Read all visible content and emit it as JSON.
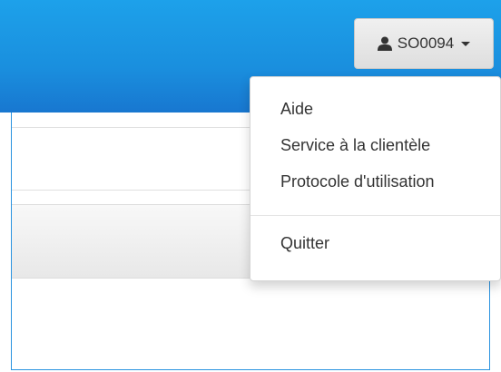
{
  "header": {
    "user_menu": {
      "label": "SO0094",
      "icon": "user-icon",
      "caret_icon": "caret-down-icon"
    }
  },
  "dropdown": {
    "items": [
      {
        "label": "Aide"
      },
      {
        "label": "Service à la clientèle"
      },
      {
        "label": "Protocole d'utilisation"
      }
    ],
    "quit_label": "Quitter"
  },
  "colors": {
    "header_blue": "#1a8fde",
    "button_gray": "#e4e4e4",
    "text": "#333333"
  }
}
